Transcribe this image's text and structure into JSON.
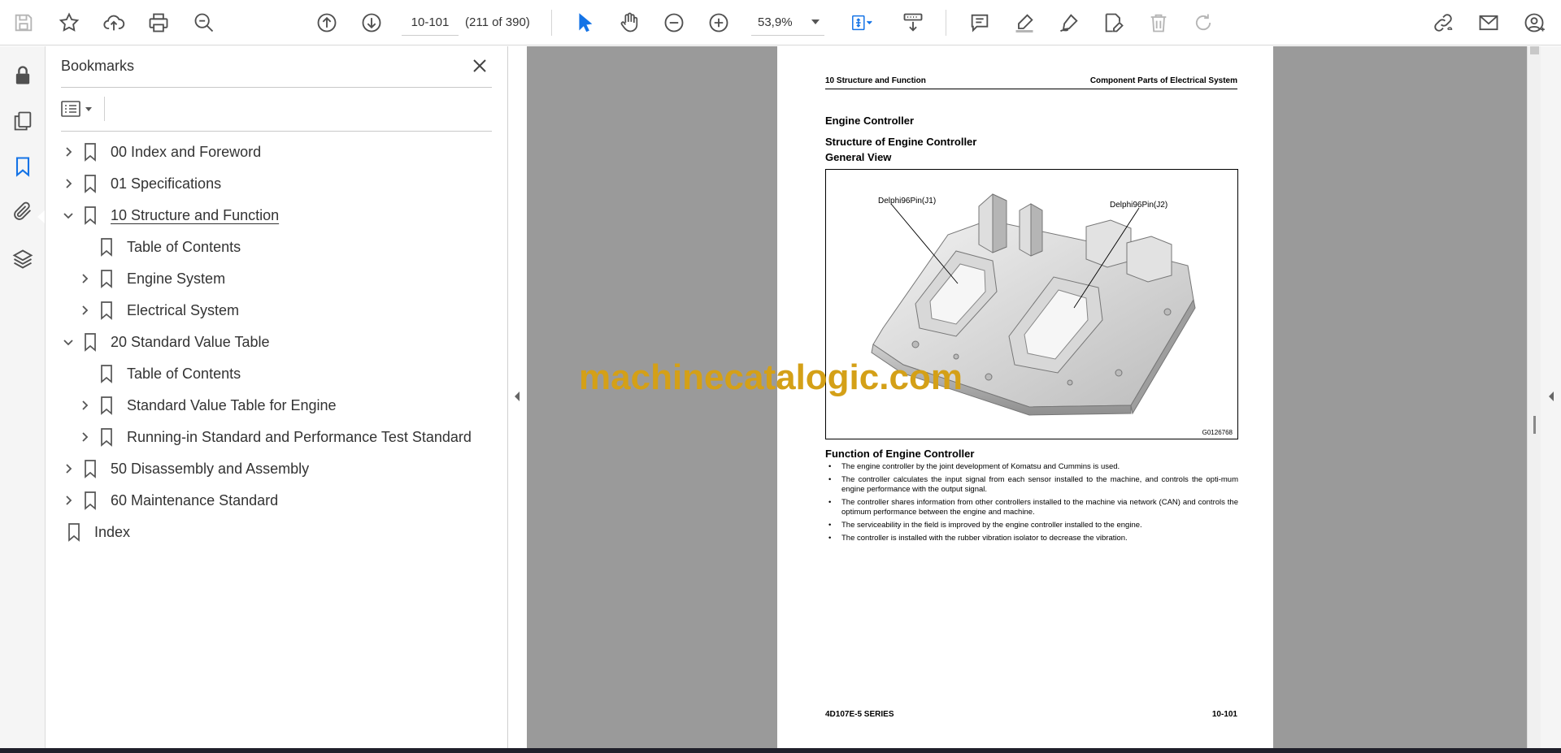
{
  "toolbar": {
    "page_input_value": "10-101",
    "page_count": "(211 of 390)",
    "zoom_value": "53,9%"
  },
  "bookmarks": {
    "title": "Bookmarks",
    "items": [
      {
        "label": "00 Index and Foreword",
        "level": 0,
        "state": "collapsed"
      },
      {
        "label": "01 Specifications",
        "level": 0,
        "state": "collapsed"
      },
      {
        "label": "10 Structure and Function",
        "level": 0,
        "state": "expanded",
        "selected": true
      },
      {
        "label": "Table of Contents",
        "level": 1,
        "state": "leaf"
      },
      {
        "label": "Engine System",
        "level": 1,
        "state": "collapsed"
      },
      {
        "label": "Electrical System",
        "level": 1,
        "state": "collapsed"
      },
      {
        "label": "20 Standard Value Table",
        "level": 0,
        "state": "expanded"
      },
      {
        "label": "Table of Contents",
        "level": 1,
        "state": "leaf"
      },
      {
        "label": "Standard Value Table for Engine",
        "level": 1,
        "state": "collapsed"
      },
      {
        "label": "Running-in Standard and Performance Test Standard",
        "level": 1,
        "state": "collapsed"
      },
      {
        "label": "50 Disassembly and Assembly",
        "level": 0,
        "state": "collapsed"
      },
      {
        "label": "60 Maintenance Standard",
        "level": 0,
        "state": "collapsed"
      },
      {
        "label": "Index",
        "level": 0,
        "state": "leaf-root"
      }
    ]
  },
  "document": {
    "header_left": "10 Structure and Function",
    "header_right": "Component Parts of Electrical System",
    "heading_engine_controller": "Engine Controller",
    "heading_structure": "Structure of Engine Controller",
    "heading_general_view": "General View",
    "figure_label_j1": "Delphi96Pin(J1)",
    "figure_label_j2": "Delphi96Pin(J2)",
    "figure_code": "G0126768",
    "heading_function": "Function of Engine Controller",
    "bullets": [
      "The engine controller by the joint development of Komatsu and Cummins is used.",
      "The controller calculates the input signal from each sensor installed to the machine, and controls the opti-mum engine performance with the output signal.",
      "The controller shares information from other controllers installed to the machine via network (CAN) and controls the optimum performance between the engine and machine.",
      "The serviceability in the field is improved by the engine controller installed to the engine.",
      "The controller is installed with the rubber vibration isolator to decrease the vibration."
    ],
    "footer_left": "4D107E-5 SERIES",
    "footer_right": "10-101"
  },
  "watermark": "machinecatalogic.com",
  "colors": {
    "accent_blue": "#1473e6",
    "icon_gray": "#505050",
    "disabled_gray": "#b5b5b5",
    "watermark": "#d4a017",
    "canvas_gray": "#9a9a9a"
  }
}
